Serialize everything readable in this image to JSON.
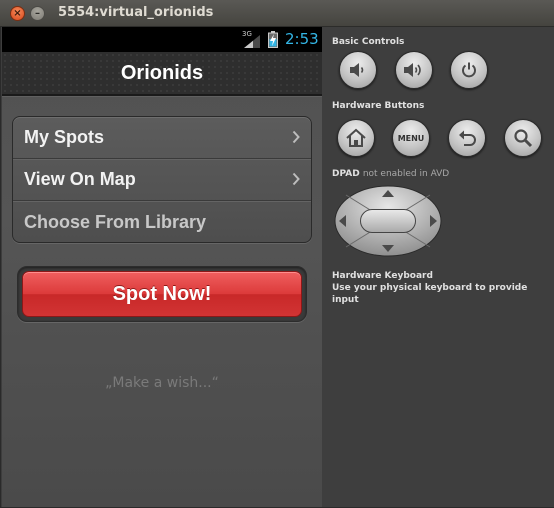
{
  "window": {
    "title": "5554:virtual_orionids"
  },
  "status_bar": {
    "network": "3G",
    "time": "2:53",
    "time_color": "#33b5e5"
  },
  "app": {
    "title": "Orionids",
    "menu_items": [
      {
        "label": "My Spots",
        "chevron": true
      },
      {
        "label": "View On Map",
        "chevron": true
      },
      {
        "label": "Choose From Library",
        "chevron": false
      }
    ],
    "spot_button": {
      "label": "Spot Now!",
      "color": "#dc3a3a"
    },
    "wish_text": "„Make a wish...“"
  },
  "controls": {
    "basic_title": "Basic Controls",
    "basic": [
      {
        "icon": "volume-down-icon"
      },
      {
        "icon": "volume-up-icon"
      },
      {
        "icon": "power-icon"
      }
    ],
    "hardware_title": "Hardware Buttons",
    "hardware": [
      {
        "icon": "home-icon"
      },
      {
        "icon": "menu-icon",
        "label": "MENU"
      },
      {
        "icon": "back-icon"
      },
      {
        "icon": "search-icon"
      }
    ],
    "dpad_title": "DPAD",
    "dpad_note": "not enabled in AVD",
    "keyboard_title": "Hardware Keyboard",
    "keyboard_note": "Use your physical keyboard to provide input"
  }
}
